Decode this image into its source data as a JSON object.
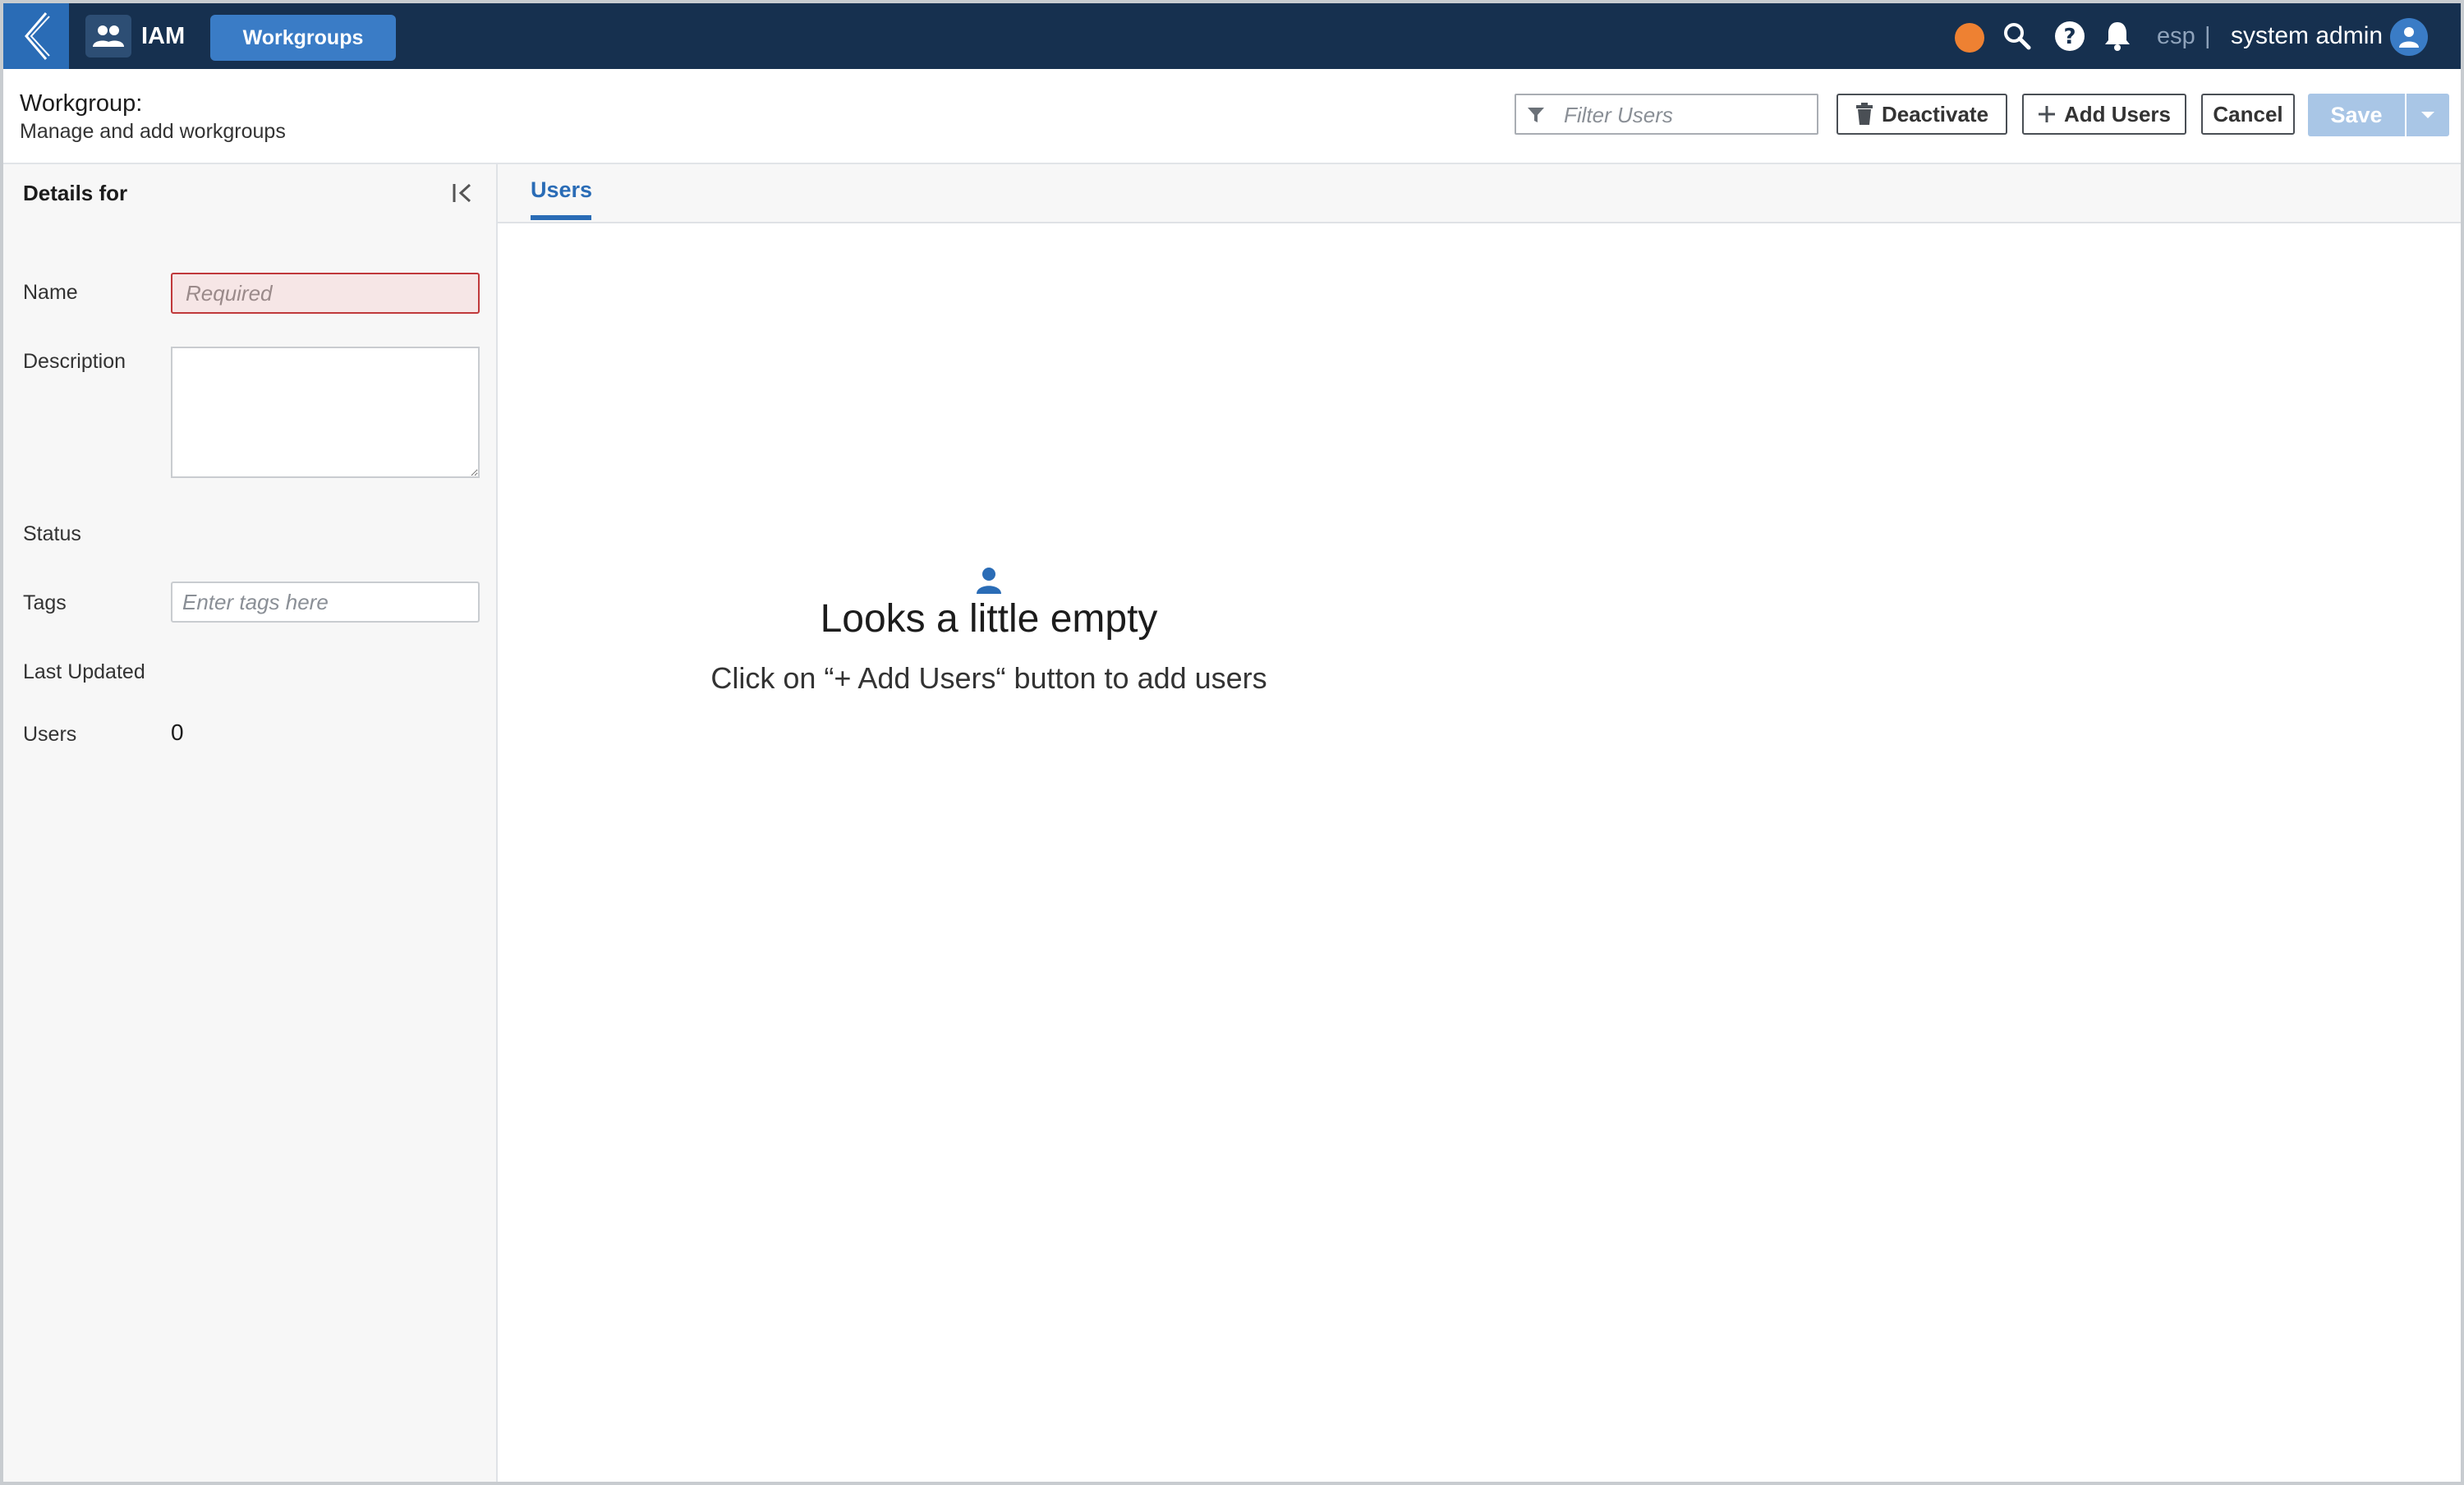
{
  "topbar": {
    "app_name": "IAM",
    "active_tab": "Workgroups",
    "language": "esp",
    "separator": "|",
    "user_name": "system admin",
    "accent_color": "#2a6cb6",
    "status_dot_color": "#ee8132"
  },
  "header": {
    "title": "Workgroup:",
    "subtitle": "Manage and add workgroups",
    "filter_placeholder": "Filter Users",
    "deactivate_label": "Deactivate",
    "add_users_label": "Add Users",
    "cancel_label": "Cancel",
    "save_label": "Save"
  },
  "details": {
    "title": "Details for",
    "name_label": "Name",
    "name_placeholder": "Required",
    "description_label": "Description",
    "status_label": "Status",
    "tags_label": "Tags",
    "tags_placeholder": "Enter tags here",
    "last_updated_label": "Last Updated",
    "users_label": "Users",
    "users_count": "0"
  },
  "main": {
    "tabs": [
      {
        "label": "Users"
      }
    ],
    "empty_state": {
      "icon": "person-icon",
      "title": "Looks a little empty",
      "message": "Click on “+ Add Users“ button to add users"
    }
  }
}
